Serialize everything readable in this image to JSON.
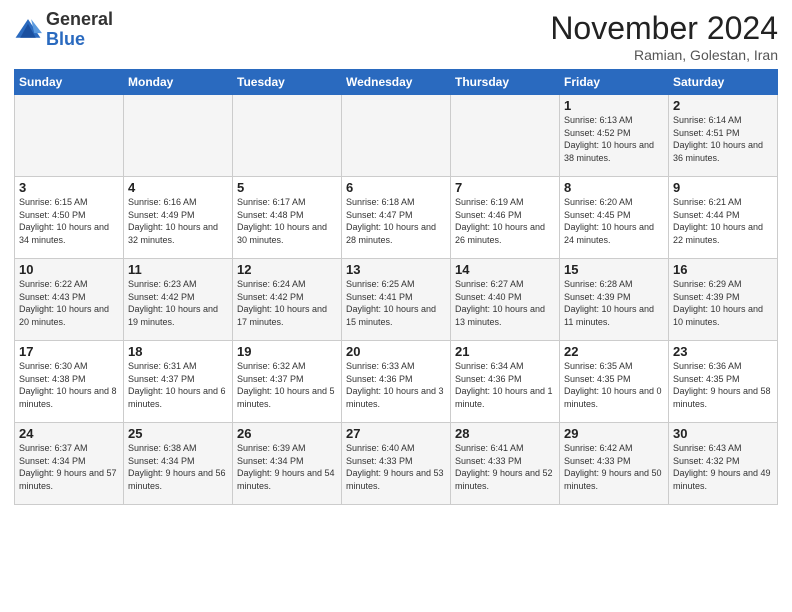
{
  "header": {
    "logo_general": "General",
    "logo_blue": "Blue",
    "month_title": "November 2024",
    "subtitle": "Ramian, Golestan, Iran"
  },
  "days_of_week": [
    "Sunday",
    "Monday",
    "Tuesday",
    "Wednesday",
    "Thursday",
    "Friday",
    "Saturday"
  ],
  "weeks": [
    [
      null,
      null,
      null,
      null,
      null,
      {
        "day": "1",
        "sunrise": "6:13 AM",
        "sunset": "4:52 PM",
        "daylight": "10 hours and 38 minutes."
      },
      {
        "day": "2",
        "sunrise": "6:14 AM",
        "sunset": "4:51 PM",
        "daylight": "10 hours and 36 minutes."
      }
    ],
    [
      {
        "day": "3",
        "sunrise": "6:15 AM",
        "sunset": "4:50 PM",
        "daylight": "10 hours and 34 minutes."
      },
      {
        "day": "4",
        "sunrise": "6:16 AM",
        "sunset": "4:49 PM",
        "daylight": "10 hours and 32 minutes."
      },
      {
        "day": "5",
        "sunrise": "6:17 AM",
        "sunset": "4:48 PM",
        "daylight": "10 hours and 30 minutes."
      },
      {
        "day": "6",
        "sunrise": "6:18 AM",
        "sunset": "4:47 PM",
        "daylight": "10 hours and 28 minutes."
      },
      {
        "day": "7",
        "sunrise": "6:19 AM",
        "sunset": "4:46 PM",
        "daylight": "10 hours and 26 minutes."
      },
      {
        "day": "8",
        "sunrise": "6:20 AM",
        "sunset": "4:45 PM",
        "daylight": "10 hours and 24 minutes."
      },
      {
        "day": "9",
        "sunrise": "6:21 AM",
        "sunset": "4:44 PM",
        "daylight": "10 hours and 22 minutes."
      }
    ],
    [
      {
        "day": "10",
        "sunrise": "6:22 AM",
        "sunset": "4:43 PM",
        "daylight": "10 hours and 20 minutes."
      },
      {
        "day": "11",
        "sunrise": "6:23 AM",
        "sunset": "4:42 PM",
        "daylight": "10 hours and 19 minutes."
      },
      {
        "day": "12",
        "sunrise": "6:24 AM",
        "sunset": "4:42 PM",
        "daylight": "10 hours and 17 minutes."
      },
      {
        "day": "13",
        "sunrise": "6:25 AM",
        "sunset": "4:41 PM",
        "daylight": "10 hours and 15 minutes."
      },
      {
        "day": "14",
        "sunrise": "6:27 AM",
        "sunset": "4:40 PM",
        "daylight": "10 hours and 13 minutes."
      },
      {
        "day": "15",
        "sunrise": "6:28 AM",
        "sunset": "4:39 PM",
        "daylight": "10 hours and 11 minutes."
      },
      {
        "day": "16",
        "sunrise": "6:29 AM",
        "sunset": "4:39 PM",
        "daylight": "10 hours and 10 minutes."
      }
    ],
    [
      {
        "day": "17",
        "sunrise": "6:30 AM",
        "sunset": "4:38 PM",
        "daylight": "10 hours and 8 minutes."
      },
      {
        "day": "18",
        "sunrise": "6:31 AM",
        "sunset": "4:37 PM",
        "daylight": "10 hours and 6 minutes."
      },
      {
        "day": "19",
        "sunrise": "6:32 AM",
        "sunset": "4:37 PM",
        "daylight": "10 hours and 5 minutes."
      },
      {
        "day": "20",
        "sunrise": "6:33 AM",
        "sunset": "4:36 PM",
        "daylight": "10 hours and 3 minutes."
      },
      {
        "day": "21",
        "sunrise": "6:34 AM",
        "sunset": "4:36 PM",
        "daylight": "10 hours and 1 minute."
      },
      {
        "day": "22",
        "sunrise": "6:35 AM",
        "sunset": "4:35 PM",
        "daylight": "10 hours and 0 minutes."
      },
      {
        "day": "23",
        "sunrise": "6:36 AM",
        "sunset": "4:35 PM",
        "daylight": "9 hours and 58 minutes."
      }
    ],
    [
      {
        "day": "24",
        "sunrise": "6:37 AM",
        "sunset": "4:34 PM",
        "daylight": "9 hours and 57 minutes."
      },
      {
        "day": "25",
        "sunrise": "6:38 AM",
        "sunset": "4:34 PM",
        "daylight": "9 hours and 56 minutes."
      },
      {
        "day": "26",
        "sunrise": "6:39 AM",
        "sunset": "4:34 PM",
        "daylight": "9 hours and 54 minutes."
      },
      {
        "day": "27",
        "sunrise": "6:40 AM",
        "sunset": "4:33 PM",
        "daylight": "9 hours and 53 minutes."
      },
      {
        "day": "28",
        "sunrise": "6:41 AM",
        "sunset": "4:33 PM",
        "daylight": "9 hours and 52 minutes."
      },
      {
        "day": "29",
        "sunrise": "6:42 AM",
        "sunset": "4:33 PM",
        "daylight": "9 hours and 50 minutes."
      },
      {
        "day": "30",
        "sunrise": "6:43 AM",
        "sunset": "4:32 PM",
        "daylight": "9 hours and 49 minutes."
      }
    ]
  ]
}
